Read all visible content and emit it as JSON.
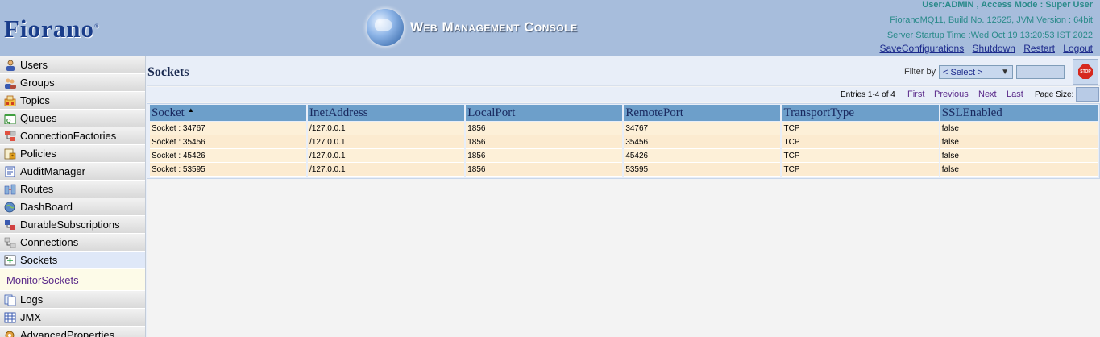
{
  "header": {
    "logo_text": "Fiorano",
    "logo_tm": "®",
    "console_title": "Web Management Console",
    "user_line": "User:ADMIN , Access Mode : Super User",
    "build_line": "FioranoMQ11, Build No. 12525, JVM Version : 64bit",
    "startup_line": "Server Startup Time :Wed Oct 19 13:20:53 IST 2022",
    "links": {
      "save": "SaveConfigurations",
      "shutdown": "Shutdown",
      "restart": "Restart",
      "logout": "Logout"
    }
  },
  "sidebar": {
    "items": [
      {
        "label": "Users",
        "icon": "users-icon"
      },
      {
        "label": "Groups",
        "icon": "groups-icon"
      },
      {
        "label": "Topics",
        "icon": "topics-icon"
      },
      {
        "label": "Queues",
        "icon": "queues-icon"
      },
      {
        "label": "ConnectionFactories",
        "icon": "connection-factories-icon"
      },
      {
        "label": "Policies",
        "icon": "policies-icon"
      },
      {
        "label": "AuditManager",
        "icon": "audit-manager-icon"
      },
      {
        "label": "Routes",
        "icon": "routes-icon"
      },
      {
        "label": "DashBoard",
        "icon": "dashboard-icon"
      },
      {
        "label": "DurableSubscriptions",
        "icon": "durable-subscriptions-icon"
      },
      {
        "label": "Connections",
        "icon": "connections-icon"
      },
      {
        "label": "Sockets",
        "icon": "sockets-icon"
      },
      {
        "label": "Logs",
        "icon": "logs-icon"
      },
      {
        "label": "JMX",
        "icon": "jmx-icon"
      },
      {
        "label": "AdvancedProperties",
        "icon": "advanced-properties-icon"
      }
    ],
    "sub_link": "MonitorSockets"
  },
  "main": {
    "title": "Sockets",
    "filter_label": "Filter by :",
    "filter_selected": "< Select >",
    "stop_label": "STOP",
    "entries": "Entries 1-4 of 4",
    "pager": {
      "first": "First",
      "previous": "Previous",
      "next": "Next",
      "last": "Last"
    },
    "page_size_label": "Page Size:"
  },
  "table": {
    "columns": [
      "Socket",
      "InetAddress",
      "LocalPort",
      "RemotePort",
      "TransportType",
      "SSLEnabled"
    ],
    "rows": [
      [
        "Socket : 34767",
        "/127.0.0.1",
        "1856",
        "34767",
        "TCP",
        "false"
      ],
      [
        "Socket : 35456",
        "/127.0.0.1",
        "1856",
        "35456",
        "TCP",
        "false"
      ],
      [
        "Socket : 45426",
        "/127.0.0.1",
        "1856",
        "45426",
        "TCP",
        "false"
      ],
      [
        "Socket : 53595",
        "/127.0.0.1",
        "1856",
        "53595",
        "TCP",
        "false"
      ]
    ]
  },
  "colors": {
    "header_bg": "#a7bddc",
    "table_header": "#6d9fca",
    "row_bg": "#fdf0d8",
    "link": "#1c2a8c"
  }
}
